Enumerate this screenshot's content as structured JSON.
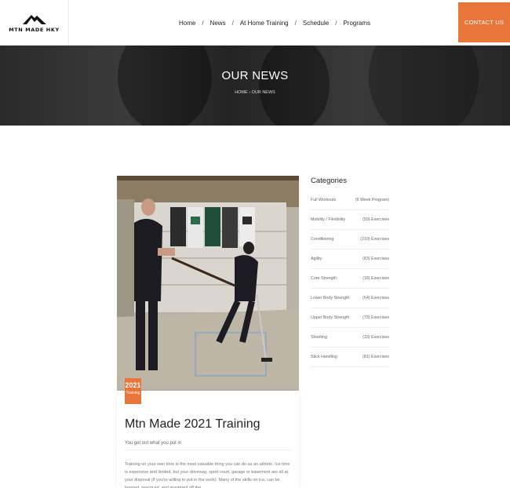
{
  "header": {
    "logo_text": "MTN MADE HKY",
    "nav": [
      {
        "label": "Home"
      },
      {
        "label": "News"
      },
      {
        "label": "At Home Training"
      },
      {
        "label": "Schedule"
      },
      {
        "label": "Programs"
      }
    ],
    "nav_separator": "/",
    "contact_label": "CONTACT US"
  },
  "hero": {
    "title": "OUR NEWS",
    "breadcrumb": {
      "home": "HOME",
      "separator": "›",
      "current": "OUR NEWS"
    }
  },
  "post": {
    "date_year": "2021",
    "date_label": "Training",
    "title": "Mtn Made 2021 Training",
    "subtitle": "You get out what you put in",
    "body": "Training on your own time is the most valuable thing you can do as an athlete. Ice time is expensive and limited, but your driveway, sport court, garage or basement are all at your disposal (if you're willing to put in the work). Many of the skills on ice, can be learned, practiced, and mastered off the"
  },
  "sidebar": {
    "title": "Categories",
    "items": [
      {
        "name": "Full Workouts",
        "count": "(6 Week Program)"
      },
      {
        "name": "Mobility / Flexibility",
        "count": "(59) Exercises"
      },
      {
        "name": "Conditioning",
        "count": "(210) Exercises"
      },
      {
        "name": "Agility",
        "count": "(83) Exercises"
      },
      {
        "name": "Core Strength",
        "count": "(18) Exercises"
      },
      {
        "name": "Lower Body Strength",
        "count": "(64) Exercises"
      },
      {
        "name": "Upper Body Strength",
        "count": "(73) Exercises"
      },
      {
        "name": "Shooting",
        "count": "(33) Exercises"
      },
      {
        "name": "Stick Handling",
        "count": "(81) Exercises"
      }
    ]
  },
  "colors": {
    "accent": "#e8763a",
    "hero_bg": "#2f2f2f"
  }
}
